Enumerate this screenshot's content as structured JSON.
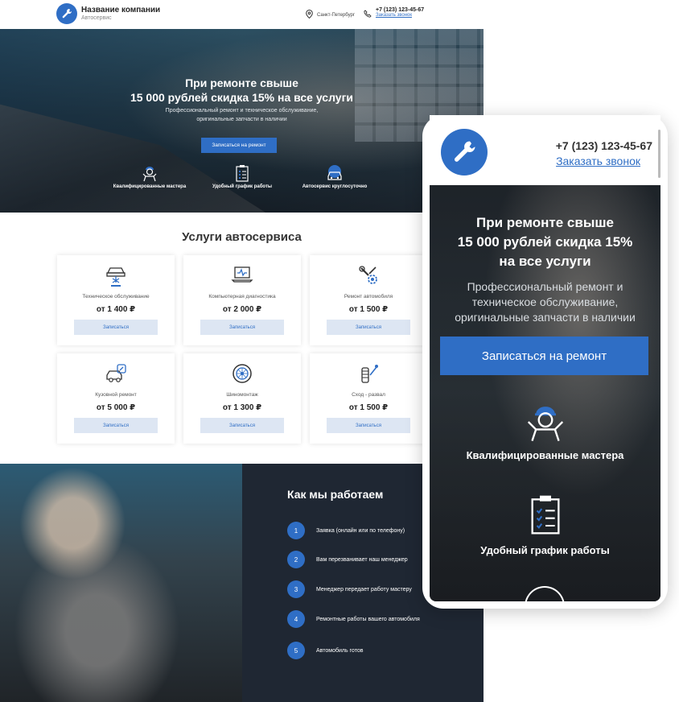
{
  "desktop": {
    "header": {
      "company_name": "Название компании",
      "company_sub": "Автосервис",
      "city": "Санкт-Петербург",
      "phone": "+7 (123) 123-45-67",
      "callback": "Заказать звонок"
    },
    "hero": {
      "title_line1": "При ремонте свыше",
      "title_line2": "15 000 рублей скидка 15% на все услуги",
      "subtitle_line1": "Профессиональный ремонт и техническое обслуживание,",
      "subtitle_line2": "оригинальные запчасти в наличии",
      "cta": "Записаться на ремонт",
      "features": [
        {
          "label": "Квалифицированные мастера",
          "icon": "mechanic-icon"
        },
        {
          "label": "Удобный график работы",
          "icon": "clipboard-icon"
        },
        {
          "label": "Автосервис круглосуточно",
          "icon": "car-24h-icon"
        }
      ]
    },
    "services": {
      "title": "Услуги автосервиса",
      "items": [
        {
          "name": "Техническое обслуживание",
          "price": "от 1 400 ₽",
          "button": "Записаться",
          "icon": "car-lift-icon"
        },
        {
          "name": "Компьютерная диагностика",
          "price": "от 2 000 ₽",
          "button": "Записаться",
          "icon": "laptop-diagnostics-icon"
        },
        {
          "name": "Ремонт автомобиля",
          "price": "от 1 500 ₽",
          "button": "Записаться",
          "icon": "wrench-gear-icon"
        },
        {
          "name": "Кузовной ремонт",
          "price": "от 5 000 ₽",
          "button": "Записаться",
          "icon": "car-body-icon"
        },
        {
          "name": "Шиномонтаж",
          "price": "от 1 300 ₽",
          "button": "Записаться",
          "icon": "tire-icon"
        },
        {
          "name": "Сход - развал",
          "price": "от 1 500 ₽",
          "button": "Записаться",
          "icon": "wheel-alignment-icon"
        }
      ]
    },
    "how": {
      "title": "Как мы работаем",
      "steps": [
        {
          "n": "1",
          "text": "Заявка (онлайн или по телефону)"
        },
        {
          "n": "2",
          "text": "Вам перезванивает наш менеджер"
        },
        {
          "n": "3",
          "text": "Менеджер передает работу мастеру"
        },
        {
          "n": "4",
          "text": "Ремонтные работы вашего автомобиля"
        },
        {
          "n": "5",
          "text": "Автомобиль готов"
        }
      ]
    }
  },
  "mobile": {
    "phone": "+7 (123) 123-45-67",
    "callback": "Заказать звонок",
    "title_line1": "При ремонте свыше",
    "title_line2": "15 000 рублей скидка 15%",
    "title_line3": "на все услуги",
    "subtitle_line1": "Профессиональный ремонт и",
    "subtitle_line2": "техническое обслуживание,",
    "subtitle_line3": "оригинальные запчасти в наличии",
    "cta": "Записаться на ремонт",
    "features": [
      {
        "label": "Квалифицированные мастера"
      },
      {
        "label": "Удобный график работы"
      }
    ]
  },
  "colors": {
    "accent": "#2f6ec5",
    "dark_panel": "#1f2733",
    "button_light": "#dde6f3"
  }
}
